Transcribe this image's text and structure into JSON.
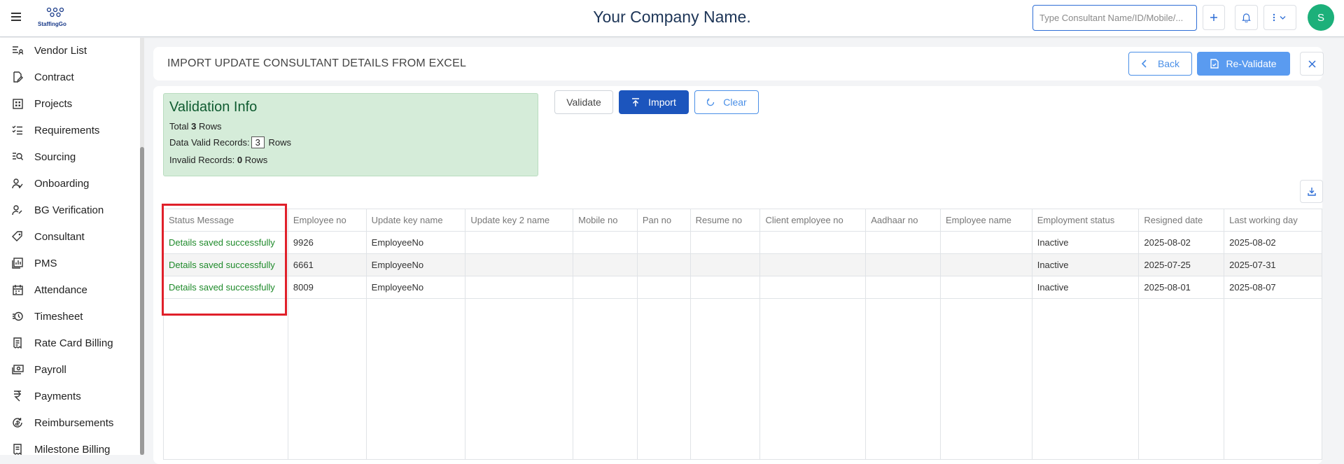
{
  "header": {
    "company_name": "Your Company Name.",
    "logo_text": "StaffingGo",
    "search_placeholder": "Type Consultant Name/ID/Mobile/...",
    "avatar_initial": "S",
    "icons": [
      "menu-icon",
      "plus-icon",
      "bell-icon",
      "more-vertical-icon",
      "chevron-down-icon"
    ]
  },
  "sidebar": {
    "items": [
      {
        "label": "Vendor List",
        "icon": "vendor-list-icon"
      },
      {
        "label": "Contract",
        "icon": "contract-icon"
      },
      {
        "label": "Projects",
        "icon": "projects-icon"
      },
      {
        "label": "Requirements",
        "icon": "requirements-icon"
      },
      {
        "label": "Sourcing",
        "icon": "sourcing-icon"
      },
      {
        "label": "Onboarding",
        "icon": "onboarding-icon"
      },
      {
        "label": "BG Verification",
        "icon": "bg-verification-icon"
      },
      {
        "label": "Consultant",
        "icon": "consultant-icon"
      },
      {
        "label": "PMS",
        "icon": "pms-icon"
      },
      {
        "label": "Attendance",
        "icon": "attendance-icon"
      },
      {
        "label": "Timesheet",
        "icon": "timesheet-icon"
      },
      {
        "label": "Rate Card Billing",
        "icon": "rate-card-icon"
      },
      {
        "label": "Payroll",
        "icon": "payroll-icon"
      },
      {
        "label": "Payments",
        "icon": "rupee-icon"
      },
      {
        "label": "Reimbursements",
        "icon": "reimbursements-icon"
      },
      {
        "label": "Milestone Billing",
        "icon": "milestone-icon"
      }
    ]
  },
  "page": {
    "title": "IMPORT UPDATE CONSULTANT DETAILS FROM EXCEL",
    "back_label": "Back",
    "revalidate_label": "Re-Validate"
  },
  "validation": {
    "title": "Validation Info",
    "total_prefix": "Total",
    "total_count": "3",
    "total_suffix": "Rows",
    "valid_prefix": "Data Valid Records:",
    "valid_count": "3",
    "valid_suffix": "Rows",
    "invalid_prefix": "Invalid Records:",
    "invalid_count": "0",
    "invalid_suffix": "Rows"
  },
  "actions": {
    "validate_label": "Validate",
    "import_label": "Import",
    "clear_label": "Clear"
  },
  "table": {
    "columns": [
      "Status Message",
      "Employee no",
      "Update key name",
      "Update key 2 name",
      "Mobile no",
      "Pan no",
      "Resume no",
      "Client employee no",
      "Aadhaar no",
      "Employee name",
      "Employment status",
      "Resigned date",
      "Last working day"
    ],
    "rows": [
      [
        "Details saved successfully",
        "9926",
        "EmployeeNo",
        "",
        "",
        "",
        "",
        "",
        "",
        "",
        "Inactive",
        "2025-08-02",
        "2025-08-02"
      ],
      [
        "Details saved successfully",
        "6661",
        "EmployeeNo",
        "",
        "",
        "",
        "",
        "",
        "",
        "",
        "Inactive",
        "2025-07-25",
        "2025-07-31"
      ],
      [
        "Details saved successfully",
        "8009",
        "EmployeeNo",
        "",
        "",
        "",
        "",
        "",
        "",
        "",
        "Inactive",
        "2025-08-01",
        "2025-08-07"
      ]
    ]
  },
  "colors": {
    "accent": "#1c55bd",
    "success_text": "#1e8a2a",
    "validation_bg": "#d5ecd9",
    "highlight": "#e0202a"
  }
}
